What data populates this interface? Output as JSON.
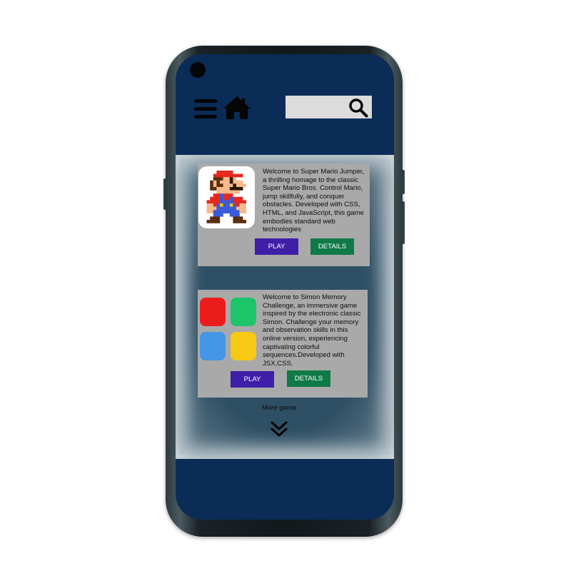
{
  "header": {
    "search": {
      "placeholder": "",
      "value": ""
    }
  },
  "games": [
    {
      "thumbnail_icon": "mario-pixel-icon",
      "description": "Welcome to Super Mario Jumper, a thrilling homage to the classic Super Mario Bros. Control Mario, jump skillfully, and conquer obstacles. Developed with CSS, HTML, and JavaScript, this game embodies standard web technologies",
      "play_label": "PLAY",
      "details_label": "DETAILS"
    },
    {
      "thumbnail_icon": "simon-board-icon",
      "description": "Welcome to Simon Memory Challenge, an immersive game inspired by the electronic classic Simon. Challenge your memory and observation skills in this online version, experiencing captivating colorful sequences.Developed with JSX,CSS.",
      "play_label": "PLAY",
      "details_label": "DETAILS"
    }
  ],
  "footer": {
    "more_label": "More game"
  },
  "colors": {
    "screen_bg": "#0a2c57",
    "card_bg": "#a9a9a9",
    "play_button": "#3f1ea8",
    "details_button": "#0f7a47",
    "simon_red": "#ec1c1c",
    "simon_green": "#1dc46a",
    "simon_blue": "#4596e6",
    "simon_yellow": "#f7c814"
  }
}
